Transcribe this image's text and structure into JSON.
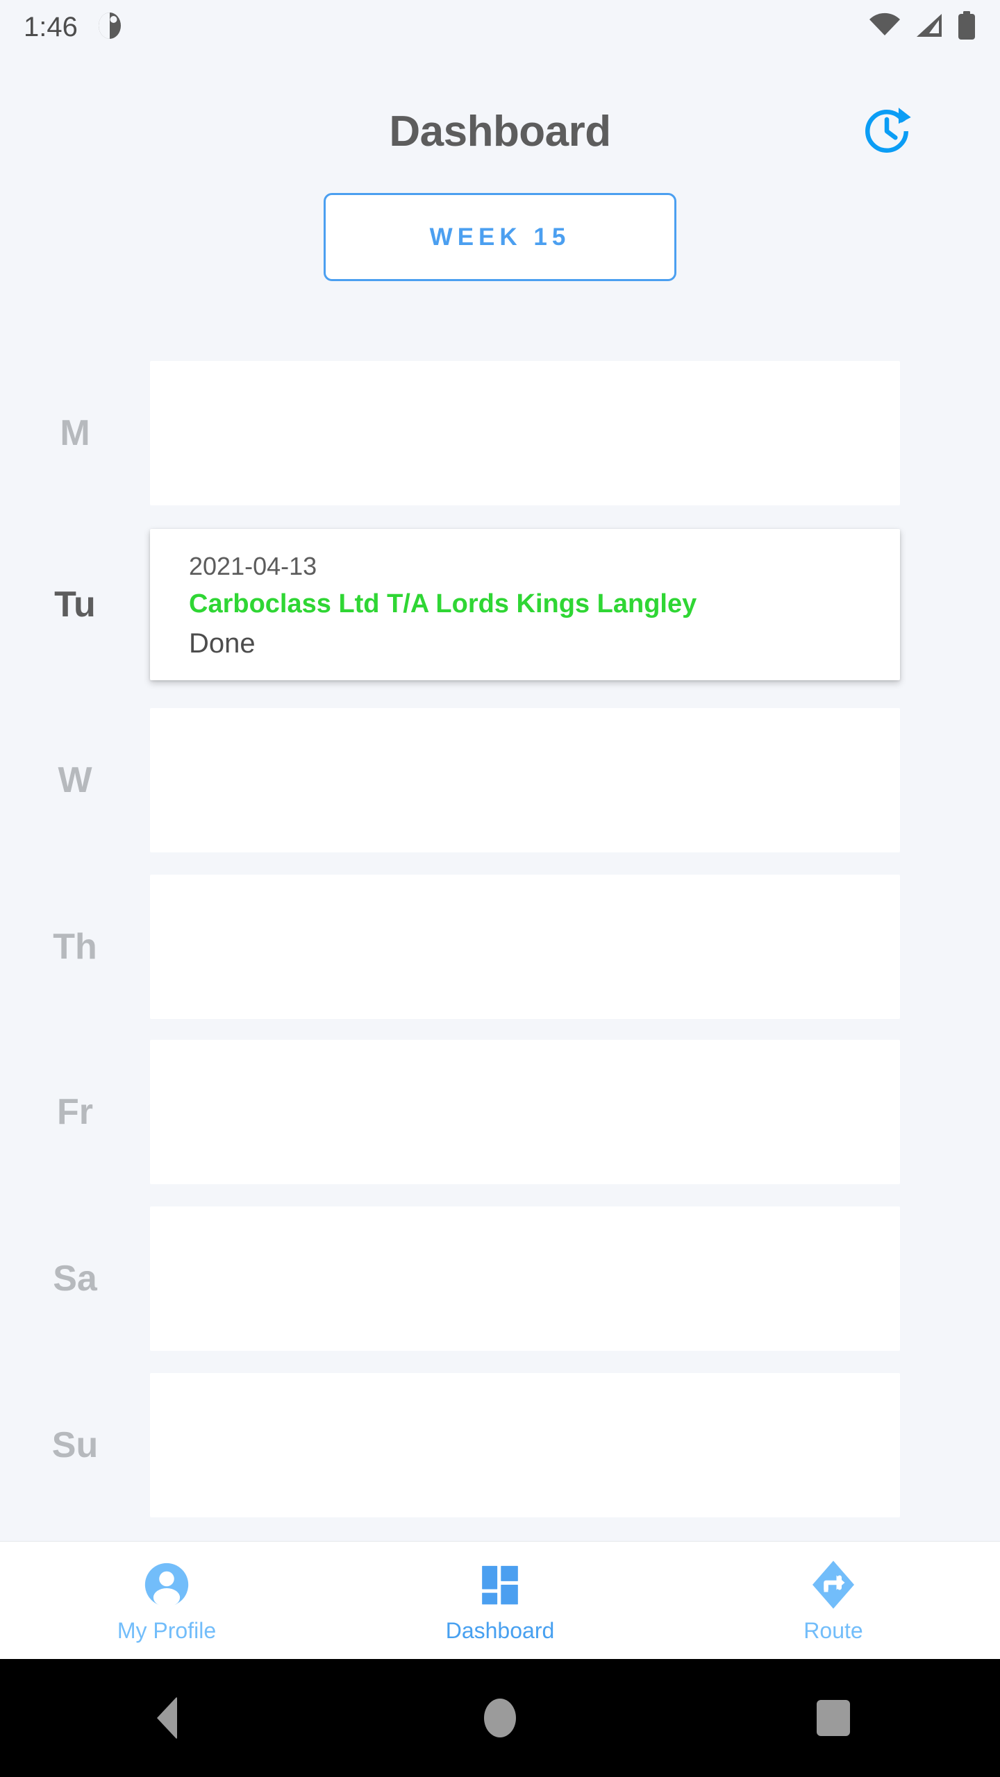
{
  "statusbar": {
    "clock": "1:46",
    "notification_icon": "notification-dot-icon",
    "wifi_icon": "wifi-icon",
    "signal_icon": "cellular-signal-icon",
    "battery_icon": "battery-full-icon"
  },
  "header": {
    "title": "Dashboard",
    "update_icon": "update-history-icon",
    "accent_color": "#0b9df5"
  },
  "week_selector": {
    "label": "WEEK 15",
    "border_color": "#4b9ff0",
    "text_color": "#4b9ff0"
  },
  "schedule": {
    "days": [
      {
        "label": "M",
        "active": false,
        "entry": null
      },
      {
        "label": "Tu",
        "active": true,
        "entry": {
          "date": "2021-04-13",
          "title": "Carboclass Ltd T/A Lords Kings Langley",
          "status": "Done",
          "title_color": "#2fd634"
        }
      },
      {
        "label": "W",
        "active": false,
        "entry": null
      },
      {
        "label": "Th",
        "active": false,
        "entry": null
      },
      {
        "label": "Fr",
        "active": false,
        "entry": null
      },
      {
        "label": "Sa",
        "active": false,
        "entry": null
      },
      {
        "label": "Su",
        "active": false,
        "entry": null
      }
    ]
  },
  "bottom_nav": {
    "items": [
      {
        "label": "My Profile",
        "icon": "account-circle-icon",
        "active": false
      },
      {
        "label": "Dashboard",
        "icon": "dashboard-grid-icon",
        "active": true
      },
      {
        "label": "Route",
        "icon": "navigation-diamond-icon",
        "active": false
      }
    ],
    "inactive_color": "#72bdfa",
    "active_color": "#47a0f0"
  },
  "android_nav": {
    "back": "back-triangle-icon",
    "home": "home-circle-icon",
    "recents": "recents-square-icon"
  }
}
